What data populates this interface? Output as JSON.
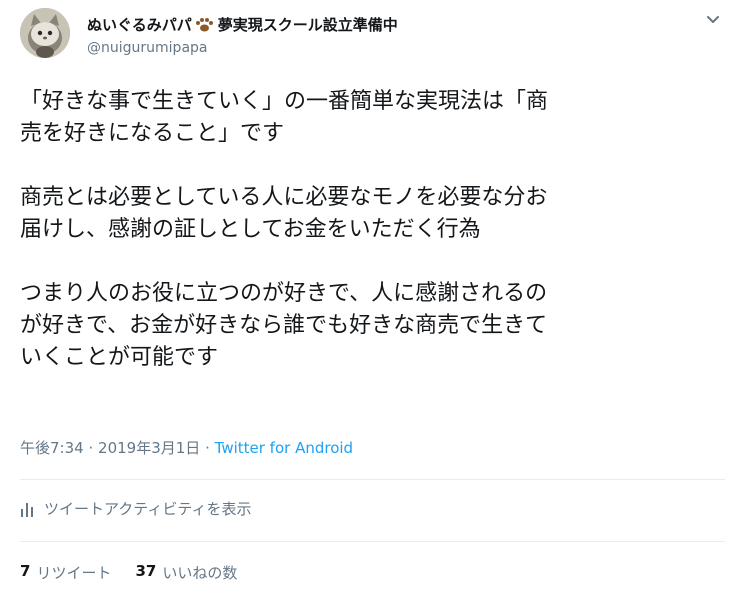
{
  "user": {
    "display_name_prefix": "ぬいぐるみパパ",
    "display_name_suffix": "夢実現スクール設立準備中",
    "handle": "@nuigurumipapa",
    "paw_icon": "paw-icon",
    "avatar_icon": "cat-plush-avatar"
  },
  "menu_icon": "chevron-down-icon",
  "tweet": {
    "lines": [
      "「好きな事で生きていく」の一番簡単な実現法は「商",
      "売を好きになること」です",
      "商売とは必要としている人に必要なモノを必要な分お",
      "届けし、感謝の証しとしてお金をいただく行為",
      "つまり人のお役に立つのが好きで、人に感謝されるの",
      "が好きで、お金が好きなら誰でも好きな商売で生きて",
      "いくことが可能です"
    ]
  },
  "meta": {
    "time": "午後7:34",
    "separator": "·",
    "date": "2019年3月1日",
    "source": "Twitter for Android"
  },
  "activity_label": "ツイートアクティビティを表示",
  "stats": {
    "retweets_count": "7",
    "retweets_label": "リツイート",
    "likes_count": "37",
    "likes_label": "いいねの数"
  },
  "colors": {
    "text": "#14171a",
    "secondary": "#657786",
    "link": "#1da1f2",
    "divider": "#e6ecf0"
  }
}
